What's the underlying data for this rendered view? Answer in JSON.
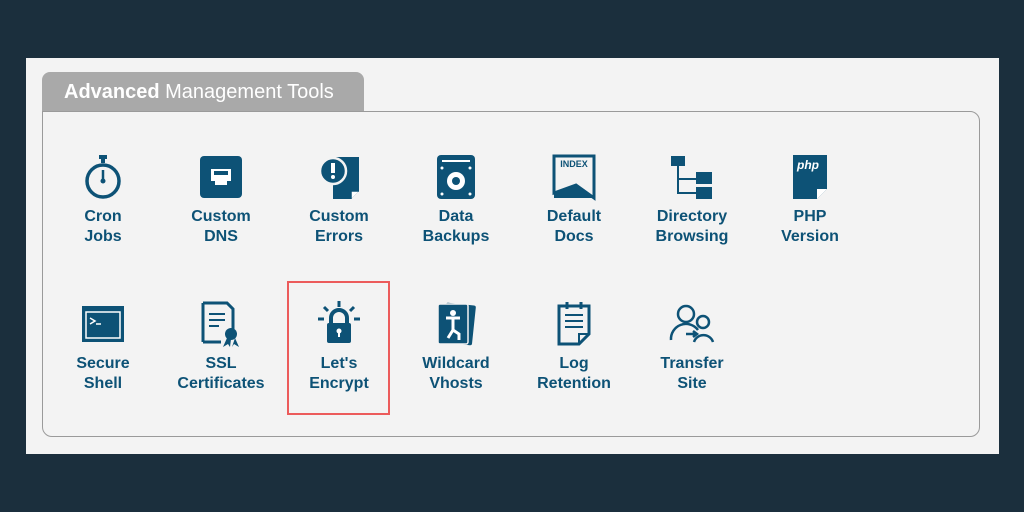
{
  "panel": {
    "tab_bold": "Advanced",
    "tab_rest": " Management Tools"
  },
  "colors": {
    "icon": "#0d5276",
    "highlight": "#ec5b5b",
    "background": "#1b2f3d"
  },
  "tools": [
    {
      "line1": "Cron",
      "line2": "Jobs",
      "icon": "stopwatch-icon"
    },
    {
      "line1": "Custom",
      "line2": "DNS",
      "icon": "network-port-icon"
    },
    {
      "line1": "Custom",
      "line2": "Errors",
      "icon": "error-page-icon"
    },
    {
      "line1": "Data",
      "line2": "Backups",
      "icon": "hard-drive-icon"
    },
    {
      "line1": "Default",
      "line2": "Docs",
      "icon": "index-doc-icon"
    },
    {
      "line1": "Directory",
      "line2": "Browsing",
      "icon": "folder-tree-icon"
    },
    {
      "line1": "PHP",
      "line2": "Version",
      "icon": "php-file-icon"
    },
    {
      "line1": "Secure",
      "line2": "Shell",
      "icon": "terminal-icon"
    },
    {
      "line1": "SSL",
      "line2": "Certificates",
      "icon": "certificate-icon"
    },
    {
      "line1": "Let's",
      "line2": "Encrypt",
      "icon": "lock-icon",
      "highlighted": true
    },
    {
      "line1": "Wildcard",
      "line2": "Vhosts",
      "icon": "wildcard-card-icon"
    },
    {
      "line1": "Log",
      "line2": "Retention",
      "icon": "notepad-icon"
    },
    {
      "line1": "Transfer",
      "line2": "Site",
      "icon": "users-transfer-icon"
    }
  ],
  "php_icon_text": "php",
  "index_icon_text": "INDEX"
}
